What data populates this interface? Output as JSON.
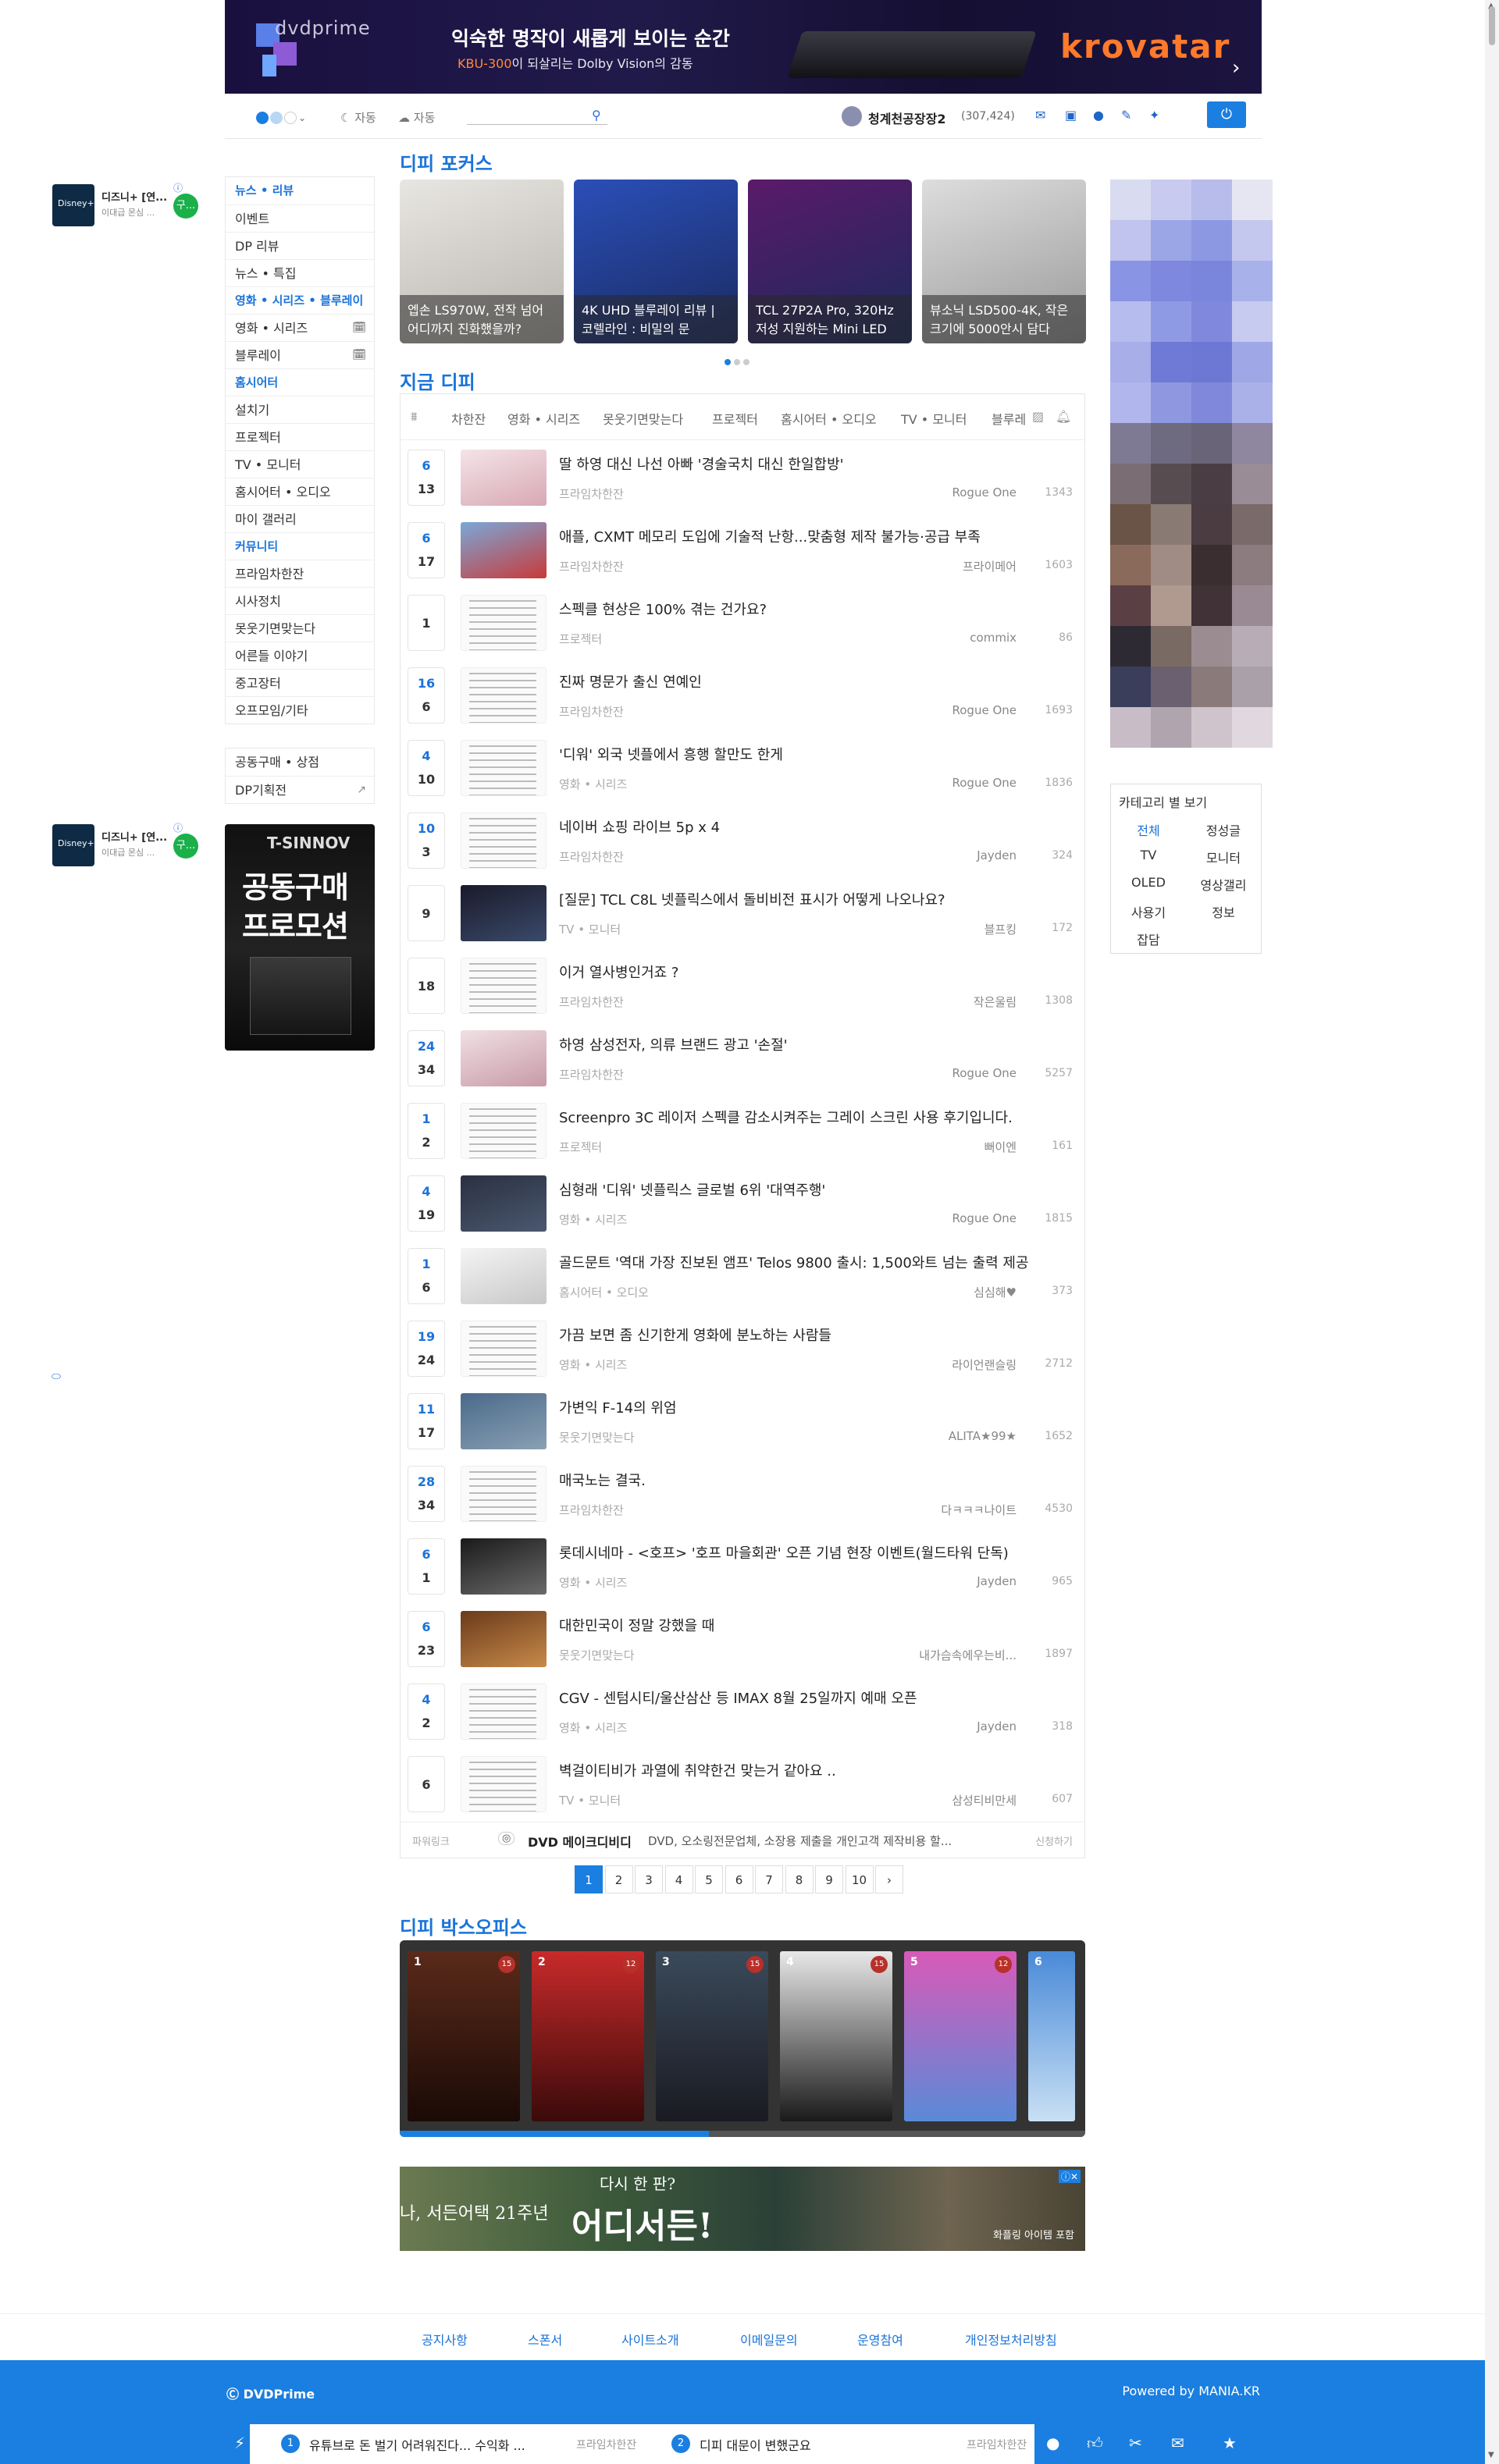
{
  "banner": {
    "brand": "dvdprime",
    "headline": "익숙한 명작이 새롭게 보이는 순간",
    "sub_highlight": "KBU-300",
    "sub_rest": "이 되살리는 Dolby Vision의 감동",
    "advertiser": "krovatar"
  },
  "topbar": {
    "auto1": "자동",
    "auto2": "자동",
    "user_name": "청계천공장장2",
    "user_count": "(307,424)"
  },
  "side_ad": {
    "title": "디즈니+ [연...",
    "sub": "이대급 몬심 ...",
    "badge": "구..."
  },
  "left_nav": [
    {
      "label": "뉴스 • 리뷰",
      "head": true
    },
    {
      "label": "이벤트"
    },
    {
      "label": "DP 리뷰"
    },
    {
      "label": "뉴스 • 특집"
    },
    {
      "label": "영화 • 시리즈 • 블루레이",
      "head": true
    },
    {
      "label": "영화 • 시리즈",
      "cal": true
    },
    {
      "label": "블루레이",
      "cal": true
    },
    {
      "label": "홈시어터",
      "head": true
    },
    {
      "label": "설치기"
    },
    {
      "label": "프로젝터"
    },
    {
      "label": "TV • 모니터"
    },
    {
      "label": "홈시어터 • 오디오"
    },
    {
      "label": "마이 갤러리"
    },
    {
      "label": "커뮤니티",
      "head": true
    },
    {
      "label": "프라임차한잔"
    },
    {
      "label": "시사정치"
    },
    {
      "label": "못웃기면맞는다"
    },
    {
      "label": "어른들 이야기"
    },
    {
      "label": "중고장터"
    },
    {
      "label": "오프모임/기타"
    }
  ],
  "left_nav2": [
    {
      "label": "공동구매 • 상점"
    },
    {
      "label": "DP기획전"
    }
  ],
  "promo": {
    "brand": "T-SINNOV",
    "line1": "공동구매",
    "line2": "프로모션"
  },
  "sections": {
    "focus": "디피 포커스",
    "now": "지금 디피",
    "box_office": "디피 박스오피스"
  },
  "focus_cards": [
    {
      "caption": "엡손 LS970W, 전작 넘어 어디까지 진화했을까?"
    },
    {
      "caption": "4K UHD 블루레이 리뷰 | 코렐라인 : 비밀의 문"
    },
    {
      "caption": "TCL 27P2A Pro, 320Hz 저성 지원하는 Mini LED"
    },
    {
      "caption": "뷰소닉 LSD500-4K, 작은 크기에 5000안시 담다"
    }
  ],
  "category_box": {
    "title": "카테고리 별 보기",
    "items": [
      "전체",
      "정성글",
      "TV",
      "모니터",
      "OLED",
      "영상갤리",
      "사용기",
      "정보",
      "잡담"
    ]
  },
  "tabs": [
    "차한잔",
    "영화 • 시리즈",
    "못웃기면맞는다",
    "프로젝터",
    "홈시어터 • 오디오",
    "TV • 모니터",
    "블루레"
  ],
  "posts": [
    {
      "v1": "6",
      "v2": "13",
      "title": "딸 하영 대신 나선 아빠 '경술국치 대신 한일합방'",
      "cat": "프라임차한잔",
      "author": "Rogue One",
      "views": "1343"
    },
    {
      "v1": "6",
      "v2": "17",
      "title": "애플, CXMT 메모리 도입에 기술적 난항...맞춤형 제작 불가능·공급 부족",
      "cat": "프라임차한잔",
      "author": "프라이메어",
      "views": "1603"
    },
    {
      "v1": "",
      "v2": "1",
      "title": "스펙클 현상은 100% 겪는 건가요?",
      "cat": "프로젝터",
      "author": "commix",
      "views": "86"
    },
    {
      "v1": "16",
      "v2": "6",
      "title": "진짜 명문가 출신 연예인",
      "cat": "프라임차한잔",
      "author": "Rogue One",
      "views": "1693"
    },
    {
      "v1": "4",
      "v2": "10",
      "title": "'디워' 외국 넷플에서 흥행 할만도 한게",
      "cat": "영화 • 시리즈",
      "author": "Rogue One",
      "views": "1836"
    },
    {
      "v1": "10",
      "v2": "3",
      "title": "네이버 쇼핑 라이브 5p x 4",
      "cat": "프라임차한잔",
      "author": "Jayden",
      "views": "324"
    },
    {
      "v1": "",
      "v2": "9",
      "title": "[질문] TCL C8L 넷플릭스에서 돌비비전 표시가 어떻게 나오나요?",
      "cat": "TV • 모니터",
      "author": "블프킹",
      "views": "172"
    },
    {
      "v1": "",
      "v2": "18",
      "title": "이거 열사병인거죠 ?",
      "cat": "프라임차한잔",
      "author": "작은울림",
      "views": "1308"
    },
    {
      "v1": "24",
      "v2": "34",
      "title": "하영 삼성전자, 의류 브랜드 광고 '손절'",
      "cat": "프라임차한잔",
      "author": "Rogue One",
      "views": "5257"
    },
    {
      "v1": "1",
      "v2": "2",
      "title": "Screenpro 3C 레이저 스펙클 감소시켜주는 그레이 스크린 사용 후기입니다.",
      "cat": "프로젝터",
      "author": "뻐이엔",
      "views": "161"
    },
    {
      "v1": "4",
      "v2": "19",
      "title": "심형래 '디워' 넷플릭스 글로벌 6위 '대역주행'",
      "cat": "영화 • 시리즈",
      "author": "Rogue One",
      "views": "1815"
    },
    {
      "v1": "1",
      "v2": "6",
      "title": "골드문트 '역대 가장 진보된 앰프' Telos 9800 출시: 1,500와트 넘는 출력 제공",
      "cat": "홈시어터 • 오디오",
      "author": "심심해♥",
      "views": "373"
    },
    {
      "v1": "19",
      "v2": "24",
      "title": "가끔 보면 좀 신기한게 영화에 분노하는 사람들",
      "cat": "영화 • 시리즈",
      "author": "라이언랜슬링",
      "views": "2712"
    },
    {
      "v1": "11",
      "v2": "17",
      "title": "가변익 F-14의 위엄",
      "cat": "못웃기면맞는다",
      "author": "ALITA★99★",
      "views": "1652"
    },
    {
      "v1": "28",
      "v2": "34",
      "title": "매국노는 결국.",
      "cat": "프라임차한잔",
      "author": "다ㅋㅋㅋ나이트",
      "views": "4530"
    },
    {
      "v1": "6",
      "v2": "1",
      "title": "롯데시네마 - <호프> '호프 마을회관' 오픈 기념 현장 이벤트(월드타워 단독)",
      "cat": "영화 • 시리즈",
      "author": "Jayden",
      "views": "965"
    },
    {
      "v1": "6",
      "v2": "23",
      "title": "대한민국이 정말 강했을 때",
      "cat": "못웃기면맞는다",
      "author": "내가슴속에우는비...",
      "views": "1897"
    },
    {
      "v1": "4",
      "v2": "2",
      "title": "CGV - 센텀시티/울산삼산 등 IMAX 8월 25일까지 예매 오픈",
      "cat": "영화 • 시리즈",
      "author": "Jayden",
      "views": "318"
    },
    {
      "v1": "",
      "v2": "6",
      "title": "벽걸이티비가 과열에 취약한건 맞는거 같아요 ..",
      "cat": "TV • 모니터",
      "author": "삼성티비만세",
      "views": "607"
    }
  ],
  "powerlink": {
    "label": "파워링크",
    "title": "DVD 메이크디비디",
    "desc": "DVD, 오소링전문업체, 소장용 제출을 개인고객 제작비용 할...",
    "apply": "신청하기"
  },
  "pagination": [
    "1",
    "2",
    "3",
    "4",
    "5",
    "6",
    "7",
    "8",
    "9",
    "10",
    "›"
  ],
  "box_office": [
    {
      "rank": "1",
      "age": "15"
    },
    {
      "rank": "2",
      "age": "12"
    },
    {
      "rank": "3",
      "age": "15"
    },
    {
      "rank": "4",
      "age": "15"
    },
    {
      "rank": "5",
      "age": "12"
    },
    {
      "rank": "6",
      "age": ""
    }
  ],
  "bottom_ad": {
    "line1": "다시 한 판?",
    "line2": "나, 서든어택 21주년",
    "line3": "어디서든!",
    "line4": "화플링 아이템 포함"
  },
  "footer": {
    "links": [
      "공지사항",
      "스폰서",
      "사이트소개",
      "이메일문의",
      "운영참여",
      "개인정보처리방침"
    ],
    "left": "Ⓒ DVDPrime",
    "right": "Powered by MANIA.KR"
  },
  "dock": [
    {
      "n": "1",
      "title": "유튜브로 돈 벌기 어려워진다... 수익화 ...",
      "cat": "프라임차한잔"
    },
    {
      "n": "2",
      "title": "디피 대문이 변했군요",
      "cat": "프라임차한잔"
    }
  ],
  "colors": {
    "accent": "#1a7fe0",
    "accent_text": "#1a73d9"
  }
}
